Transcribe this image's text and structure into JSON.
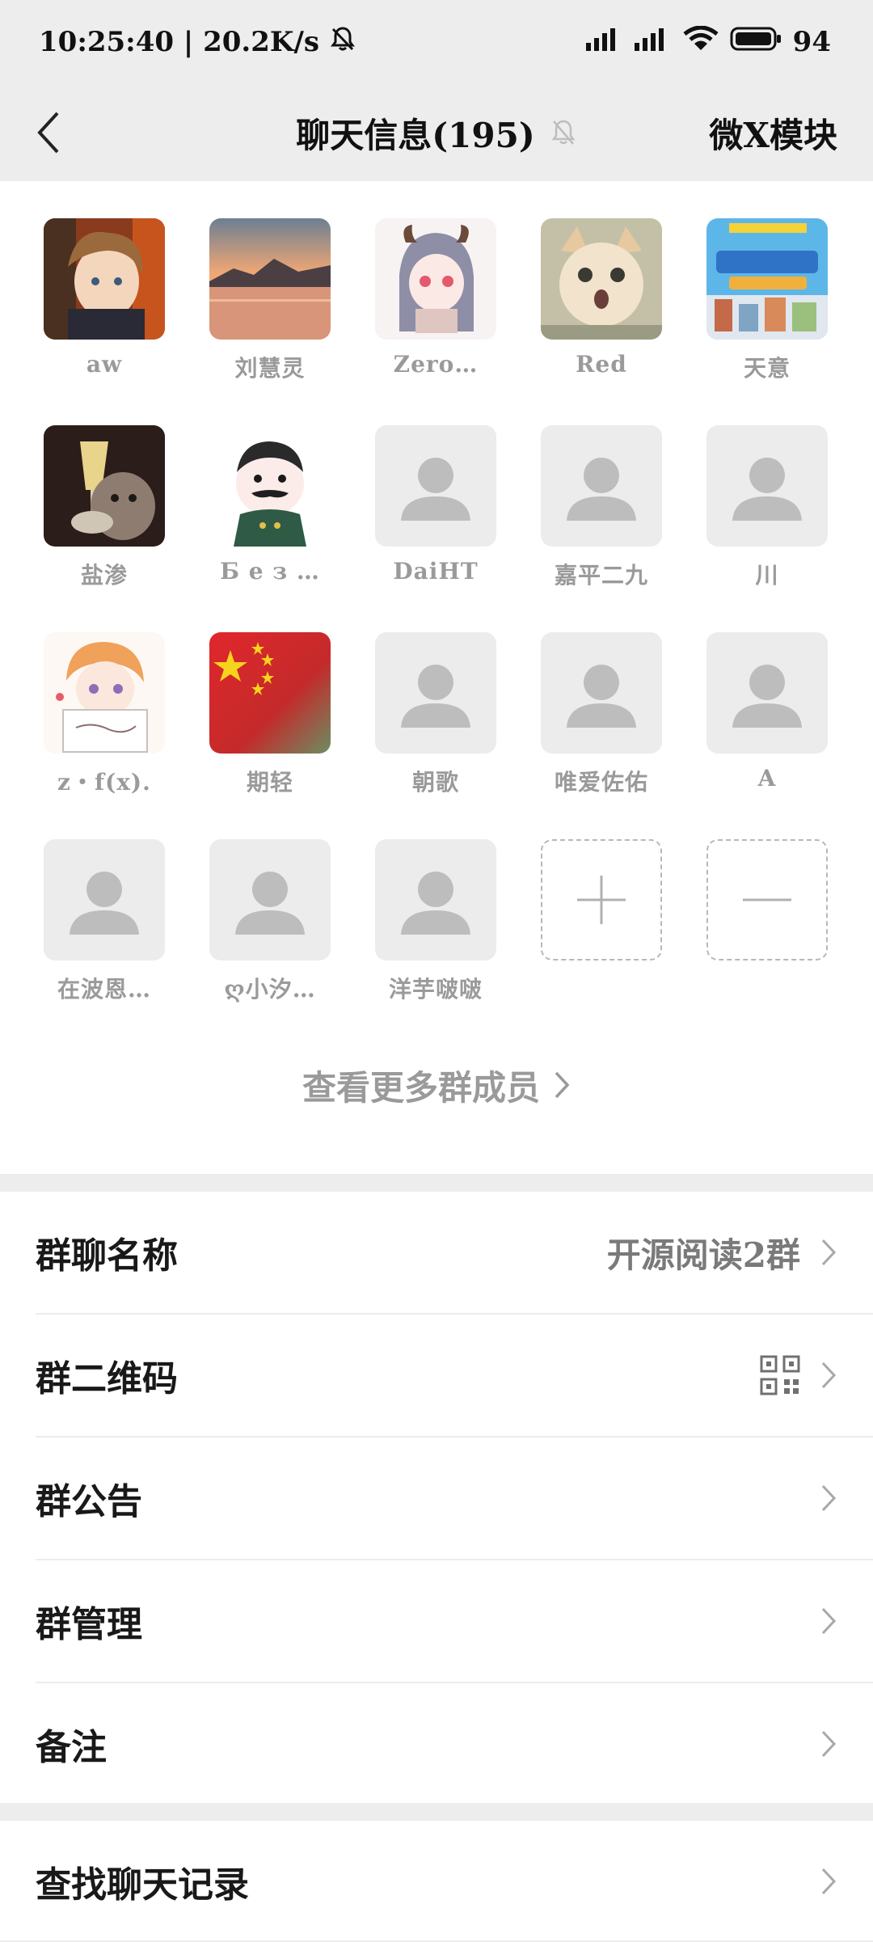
{
  "status": {
    "time_speed": "10:25:40 | 20.2K/s",
    "battery": "94"
  },
  "nav": {
    "title": "聊天信息(195)",
    "right_label": "微X模块"
  },
  "members": [
    {
      "name": "aw",
      "avatar": "anime-boy"
    },
    {
      "name": "刘慧灵",
      "avatar": "sunset-lake"
    },
    {
      "name": "Zero…",
      "avatar": "anime-girl"
    },
    {
      "name": "Red",
      "avatar": "cat"
    },
    {
      "name": "天意",
      "avatar": "poster"
    },
    {
      "name": "盐渗",
      "avatar": "cat-drink"
    },
    {
      "name": "Б е з …",
      "avatar": "cartoon-man"
    },
    {
      "name": "DaiHT",
      "avatar": "default"
    },
    {
      "name": "嘉平二九",
      "avatar": "default"
    },
    {
      "name": "川",
      "avatar": "default"
    },
    {
      "name": "z・f(x).",
      "avatar": "anime-boy-sign"
    },
    {
      "name": "期轻",
      "avatar": "flag"
    },
    {
      "name": "朝歌",
      "avatar": "default"
    },
    {
      "name": "唯爱佐佑",
      "avatar": "default"
    },
    {
      "name": "A",
      "avatar": "default"
    },
    {
      "name": "在波恩…",
      "avatar": "default"
    },
    {
      "name": "ღ小汐…",
      "avatar": "default"
    },
    {
      "name": "洋芋啵啵",
      "avatar": "default"
    }
  ],
  "actions": {
    "add": "add-member",
    "remove": "remove-member"
  },
  "more_members": "查看更多群成员",
  "settings": {
    "group_name_label": "群聊名称",
    "group_name_value": "开源阅读2群",
    "qr_label": "群二维码",
    "notice_label": "群公告",
    "manage_label": "群管理",
    "remark_label": "备注"
  },
  "search_label": "查找聊天记录",
  "colors": {
    "background": "#ededed",
    "card": "#ffffff",
    "muted_text": "#9a9a9a"
  }
}
